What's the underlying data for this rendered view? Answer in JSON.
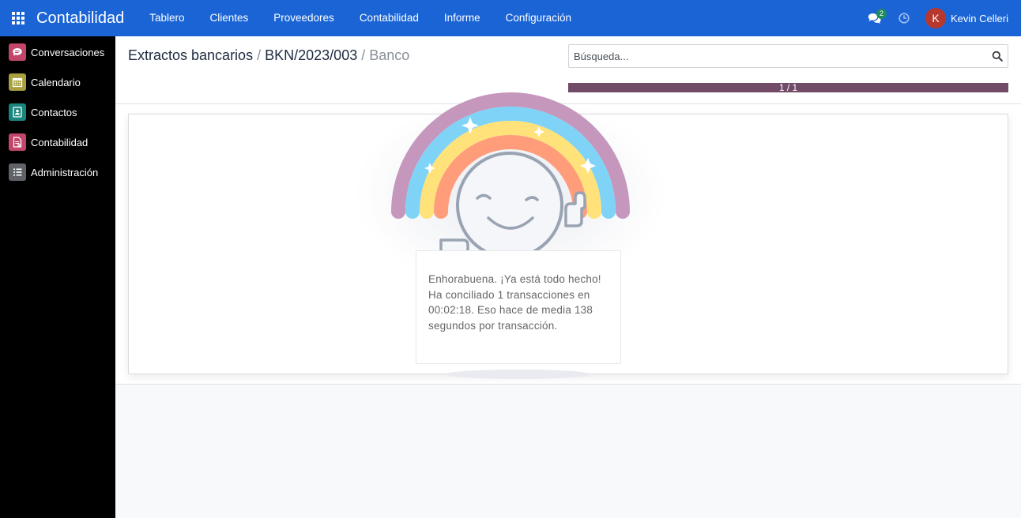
{
  "navbar": {
    "app_name": "Contabilidad",
    "menu": [
      "Tablero",
      "Clientes",
      "Proveedores",
      "Contabilidad",
      "Informe",
      "Configuración"
    ],
    "chat_badge": "2",
    "user_initial": "K",
    "user_name": "Kevin Celleri",
    "color": "#1a64d6"
  },
  "sidebar": {
    "items": [
      {
        "label": "Conversaciones",
        "icon": "chat-bubble-icon",
        "color": "#c2466a"
      },
      {
        "label": "Calendario",
        "icon": "calendar-icon",
        "color": "#a8a03e"
      },
      {
        "label": "Contactos",
        "icon": "contact-card-icon",
        "color": "#18867c"
      },
      {
        "label": "Contabilidad",
        "icon": "invoice-icon",
        "color": "#c2466a"
      },
      {
        "label": "Administración",
        "icon": "settings-list-icon",
        "color": "#5f6368"
      }
    ]
  },
  "breadcrumb": {
    "items": [
      "Extractos bancarios",
      "BKN/2023/003"
    ],
    "separator": "/",
    "active": "Banco"
  },
  "search": {
    "placeholder": "Búsqueda..."
  },
  "progress": {
    "text": "1 / 1",
    "percent": 100,
    "color": "#714b67"
  },
  "message": {
    "text": "Enhorabuena. ¡Ya está todo hecho! Ha conciliado 1 transacciones en 00:02:18. Eso hace de media 138 segundos por transacción."
  }
}
